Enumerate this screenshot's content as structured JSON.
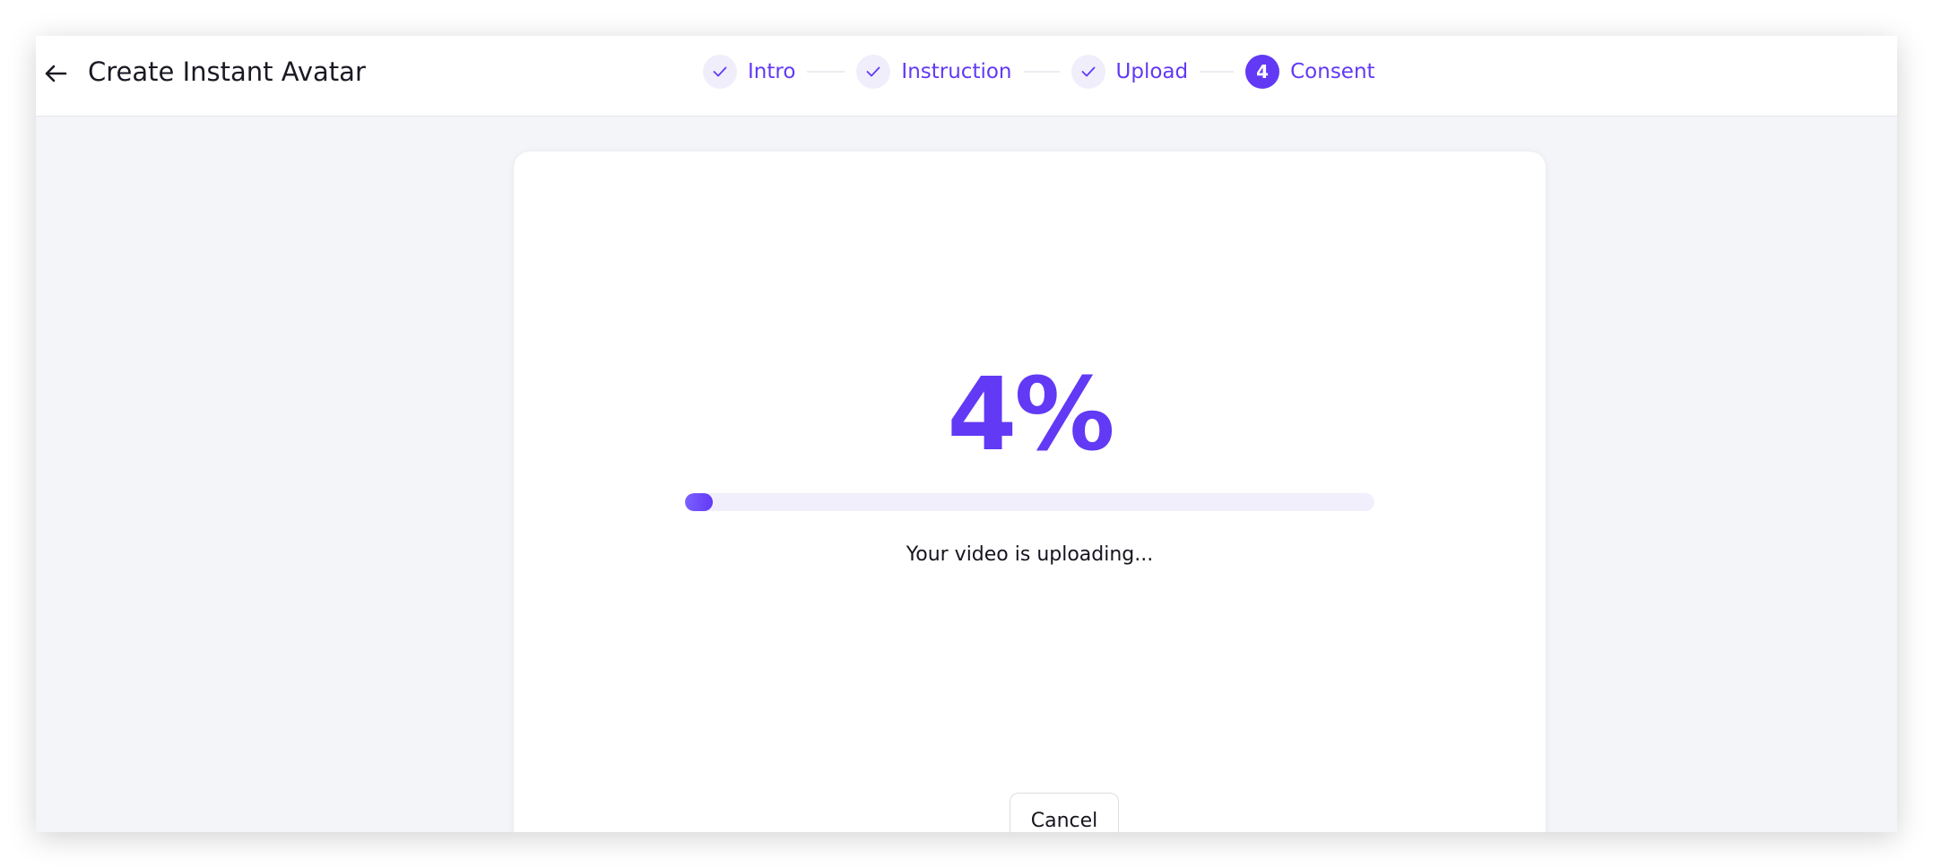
{
  "header": {
    "title": "Create Instant Avatar",
    "back_icon": "arrow-left-icon"
  },
  "steps": [
    {
      "label": "Intro",
      "status": "done",
      "icon": "check-icon"
    },
    {
      "label": "Instruction",
      "status": "done",
      "icon": "check-icon"
    },
    {
      "label": "Upload",
      "status": "done",
      "icon": "check-icon"
    },
    {
      "label": "Consent",
      "status": "active",
      "number": "4"
    }
  ],
  "upload": {
    "percent_text": "4%",
    "progress_fraction": 0.04,
    "status": "Your video is uploading...",
    "cancel_label": "Cancel"
  },
  "colors": {
    "accent": "#6239f5",
    "step_done_bg": "#f0eefb",
    "progress_track": "#f1effc",
    "page_bg": "#f4f5f8"
  }
}
